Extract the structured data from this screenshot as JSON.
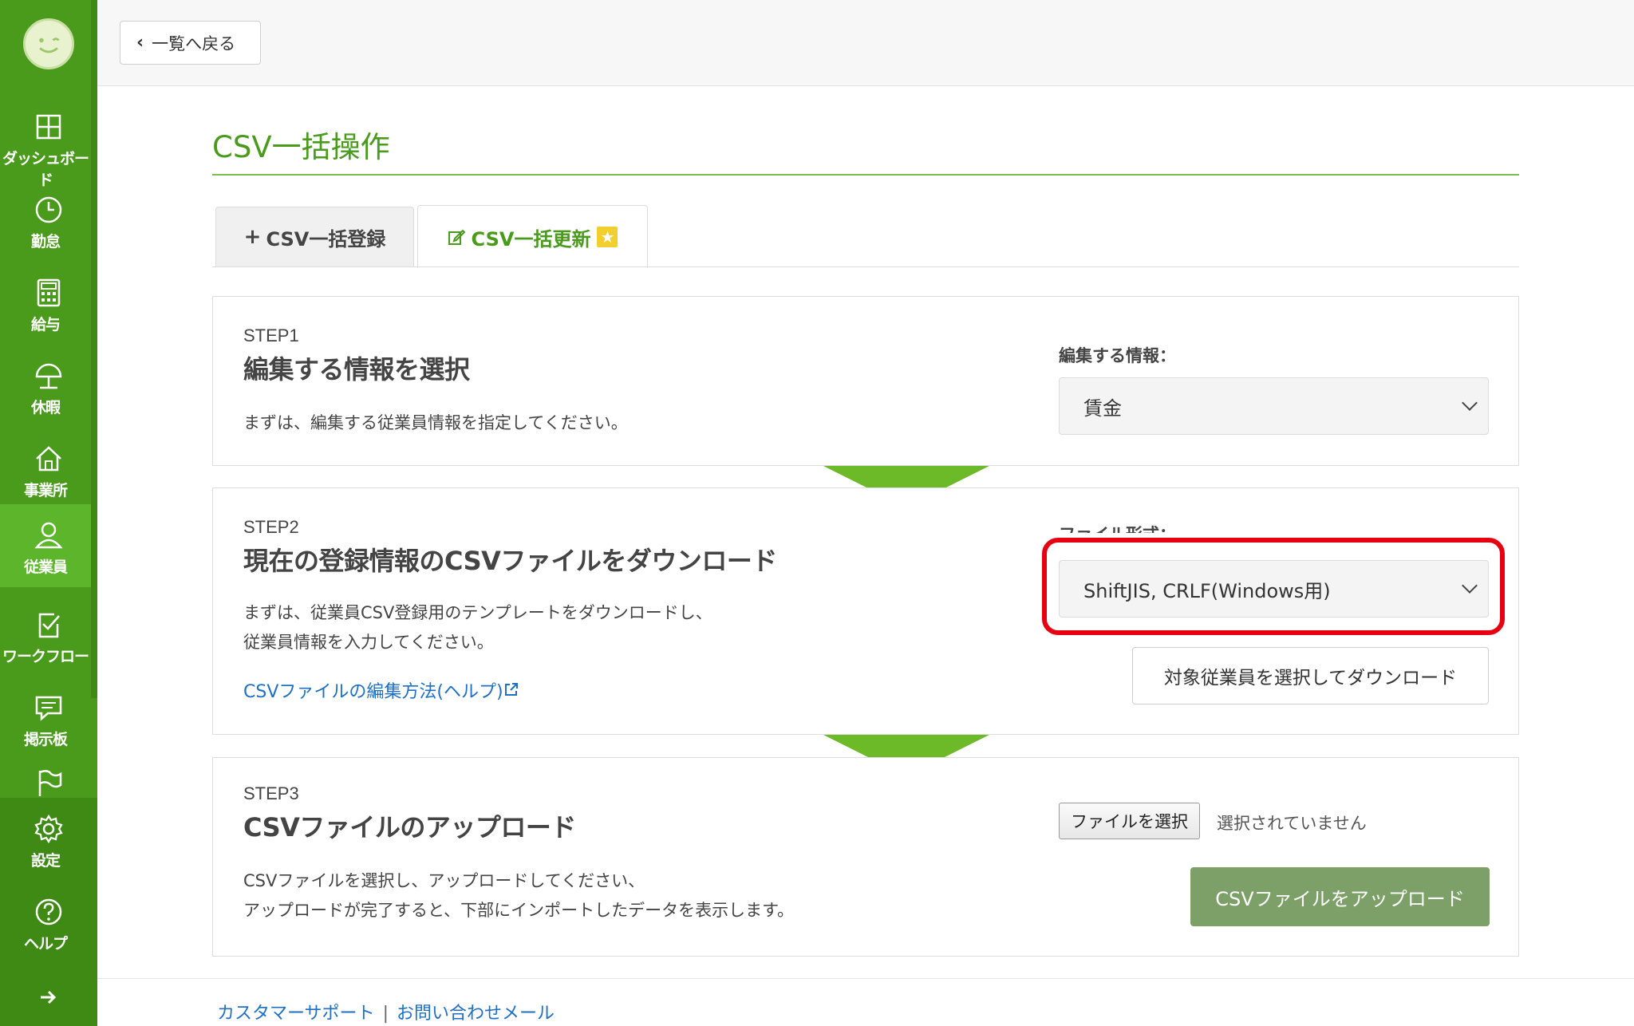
{
  "topbar": {
    "back_label": "一覧へ戻る"
  },
  "sidebar": {
    "items": [
      {
        "label": "ダッシュボード",
        "icon": "dashboard-icon"
      },
      {
        "label": "勤怠",
        "icon": "clock-icon"
      },
      {
        "label": "給与",
        "icon": "calculator-icon"
      },
      {
        "label": "休暇",
        "icon": "parasol-icon"
      },
      {
        "label": "事業所",
        "icon": "home-icon"
      },
      {
        "label": "従業員",
        "icon": "user-icon",
        "active": true
      },
      {
        "label": "ワークフロー",
        "icon": "clipboard-check-icon"
      },
      {
        "label": "掲示板",
        "icon": "chat-icon"
      },
      {
        "label": "",
        "icon": "flag-icon"
      },
      {
        "label": "設定",
        "icon": "gear-icon"
      },
      {
        "label": "ヘルプ",
        "icon": "help-icon"
      }
    ],
    "expand_icon": "arrow-right-icon"
  },
  "page": {
    "title": "CSV一括操作"
  },
  "tabs": [
    {
      "label": "CSV一括登録",
      "icon": "plus-icon"
    },
    {
      "label": "CSV一括更新",
      "icon": "edit-icon",
      "badge_icon": "star-icon",
      "active": true
    }
  ],
  "step1": {
    "label": "STEP1",
    "title": "編集する情報を選択",
    "desc": "まずは、編集する従業員情報を指定してください。",
    "field_label": "編集する情報：",
    "select_value": "賃金"
  },
  "step2": {
    "label": "STEP2",
    "title": "現在の登録情報のCSVファイルをダウンロード",
    "desc_line1": "まずは、従業員CSV登録用のテンプレートをダウンロードし、",
    "desc_line2": "従業員情報を入力してください。",
    "help_link": "CSVファイルの編集方法(ヘルプ)",
    "field_label": "ファイル形式：",
    "select_value": "ShiftJIS, CRLF(Windows用)",
    "download_button": "対象従業員を選択してダウンロード"
  },
  "step3": {
    "label": "STEP3",
    "title": "CSVファイルのアップロード",
    "desc_line1": "CSVファイルを選択し、アップロードしてください、",
    "desc_line2": "アップロードが完了すると、下部にインポートしたデータを表示します。",
    "file_button": "ファイルを選択",
    "file_status": "選択されていません",
    "upload_button": "CSVファイルをアップロード"
  },
  "footer": {
    "support": "カスタマーサポート",
    "sep": "|",
    "mail": "お問い合わせメール"
  },
  "colors": {
    "brand_green": "#4a9a1c",
    "highlight_red": "#e60012",
    "link_blue": "#1f6fc5"
  }
}
